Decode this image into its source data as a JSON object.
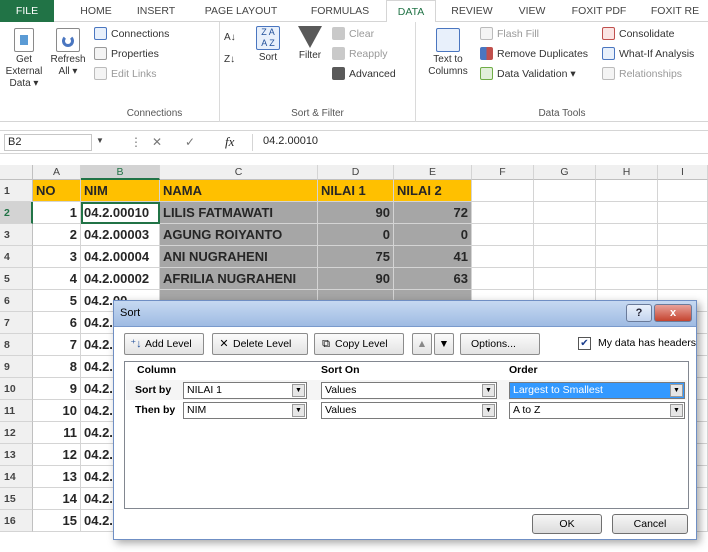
{
  "tabs": [
    "FILE",
    "HOME",
    "INSERT",
    "PAGE LAYOUT",
    "FORMULAS",
    "DATA",
    "REVIEW",
    "VIEW",
    "FOXIT PDF",
    "FOXIT RE"
  ],
  "ribbon": {
    "get_external": "Get External Data ▾",
    "refresh": "Refresh All ▾",
    "connections": "Connections",
    "properties": "Properties",
    "edit_links": "Edit Links",
    "group_connections": "Connections",
    "sort": "Sort",
    "filter": "Filter",
    "clear": "Clear",
    "reapply": "Reapply",
    "advanced": "Advanced",
    "group_sort_filter": "Sort & Filter",
    "text_to_columns": "Text to Columns",
    "flash_fill": "Flash Fill",
    "remove_duplicates": "Remove Duplicates",
    "data_validation": "Data Validation ▾",
    "consolidate": "Consolidate",
    "what_if": "What-If Analysis",
    "relationships": "Relationships",
    "group_data_tools": "Data Tools"
  },
  "formula_bar": {
    "name_box": "B2",
    "fx": "fx",
    "content": "04.2.00010"
  },
  "columns": [
    "A",
    "B",
    "C",
    "D",
    "E",
    "F",
    "G",
    "H",
    "I"
  ],
  "rows": [
    "1",
    "2",
    "3",
    "4",
    "5",
    "6",
    "7",
    "8",
    "9",
    "10",
    "11",
    "12",
    "13",
    "14",
    "15",
    "16"
  ],
  "table": {
    "headers": [
      "NO",
      "NIM",
      "NAMA",
      "NILAI 1",
      "NILAI 2"
    ],
    "data": [
      [
        "1",
        "04.2.00010",
        "LILIS FATMAWATI",
        "90",
        "72"
      ],
      [
        "2",
        "04.2.00003",
        "AGUNG ROIYANTO",
        "0",
        "0"
      ],
      [
        "3",
        "04.2.00004",
        "ANI NUGRAHENI",
        "75",
        "41"
      ],
      [
        "4",
        "04.2.00002",
        "AFRILIA NUGRAHENI",
        "90",
        "63"
      ],
      [
        "5",
        "04.2.00",
        ""
      ],
      [
        "6",
        "04.2.00",
        ""
      ],
      [
        "7",
        "04.2.00",
        ""
      ],
      [
        "8",
        "04.2.00",
        ""
      ],
      [
        "9",
        "04.2.00",
        ""
      ],
      [
        "10",
        "04.2.00",
        ""
      ],
      [
        "11",
        "04.2.00",
        ""
      ],
      [
        "12",
        "04.2.00",
        ""
      ],
      [
        "13",
        "04.2.00",
        ""
      ],
      [
        "14",
        "04.2.00",
        ""
      ],
      [
        "15",
        "04.2.00"
      ]
    ]
  },
  "dialog": {
    "title": "Sort",
    "help": "?",
    "close": "x",
    "add_level": "Add Level",
    "delete_level": "Delete Level",
    "copy_level": "Copy Level",
    "up": "▲",
    "down": "▼",
    "options": "Options...",
    "my_data_has_headers": "My data has headers",
    "checked": "✔",
    "col_header": "Column",
    "sort_on_header": "Sort On",
    "order_header": "Order",
    "levels": [
      {
        "label": "Sort by",
        "column": "NILAI 1",
        "sort_on": "Values",
        "order": "Largest to Smallest"
      },
      {
        "label": "Then by",
        "column": "NIM",
        "sort_on": "Values",
        "order": "A to Z"
      }
    ],
    "ok": "OK",
    "cancel": "Cancel"
  }
}
